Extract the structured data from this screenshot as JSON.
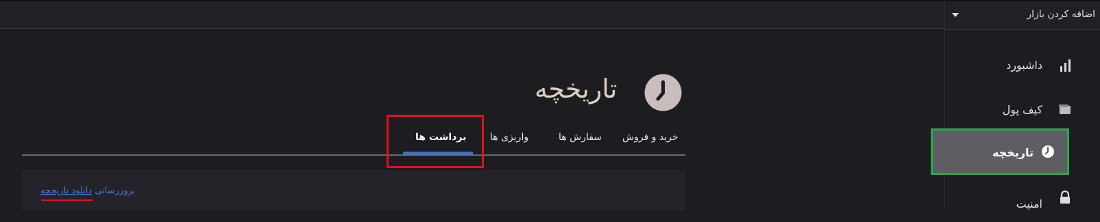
{
  "header": {
    "market_selector_label": "اضافه کردن بازار"
  },
  "sidebar": {
    "items": [
      {
        "label": "داشبورد",
        "icon": "bar-chart-icon"
      },
      {
        "label": "کیف پول",
        "icon": "wallet-icon"
      },
      {
        "label": "تاریخچه",
        "icon": "clock-icon",
        "active": true
      },
      {
        "label": "امنیت",
        "icon": "lock-icon"
      }
    ]
  },
  "main": {
    "title": "تاریخچه",
    "title_icon": "clock-icon",
    "tabs": [
      {
        "label": "خرید و فروش"
      },
      {
        "label": "سفارش ها"
      },
      {
        "label": "واریزی ها"
      },
      {
        "label": "برداشت ها",
        "active": true
      }
    ],
    "actions": {
      "refresh_label": "بروزرسانی",
      "download_label": "دانلود تاریخچه"
    }
  },
  "colors": {
    "background": "#1d1c20",
    "active_tab_underline": "#3c6fd6",
    "active_sidebar_bg": "#5e5d62",
    "link": "#4a7bd9",
    "annotation_red": "#e11020",
    "annotation_green": "#2ba84a"
  }
}
